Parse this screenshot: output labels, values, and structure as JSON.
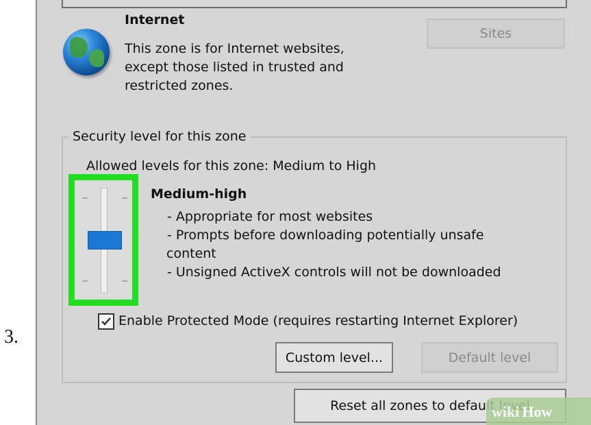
{
  "step": {
    "number": "3."
  },
  "zone": {
    "icon": "globe-icon",
    "title": "Internet",
    "description_lines": [
      "This zone is for Internet websites,",
      "except those listed in trusted and",
      "restricted zones."
    ],
    "sites_button": "Sites"
  },
  "security": {
    "group_label": "Security level for this zone",
    "allowed_levels": "Allowed levels for this zone: Medium to High",
    "slider": {
      "level_fraction": 0.5,
      "highlight_color": "#22dd22"
    },
    "level_name": "Medium-high",
    "level_details": [
      "- Appropriate for most websites",
      "- Prompts before downloading potentially unsafe",
      "content",
      "- Unsigned ActiveX controls will not be downloaded"
    ],
    "protected_mode": {
      "label": "Enable Protected Mode (requires restarting Internet Explorer)",
      "checked": true
    },
    "custom_level_button": "Custom level...",
    "default_level_button": "Default level"
  },
  "reset_button": "Reset all zones to default level",
  "watermark": {
    "wiki": "wiki",
    "how": "How"
  },
  "colors": {
    "panel_bg": "#d6d6d6",
    "slider_thumb": "#1a78d4",
    "highlight": "#22dd22"
  }
}
